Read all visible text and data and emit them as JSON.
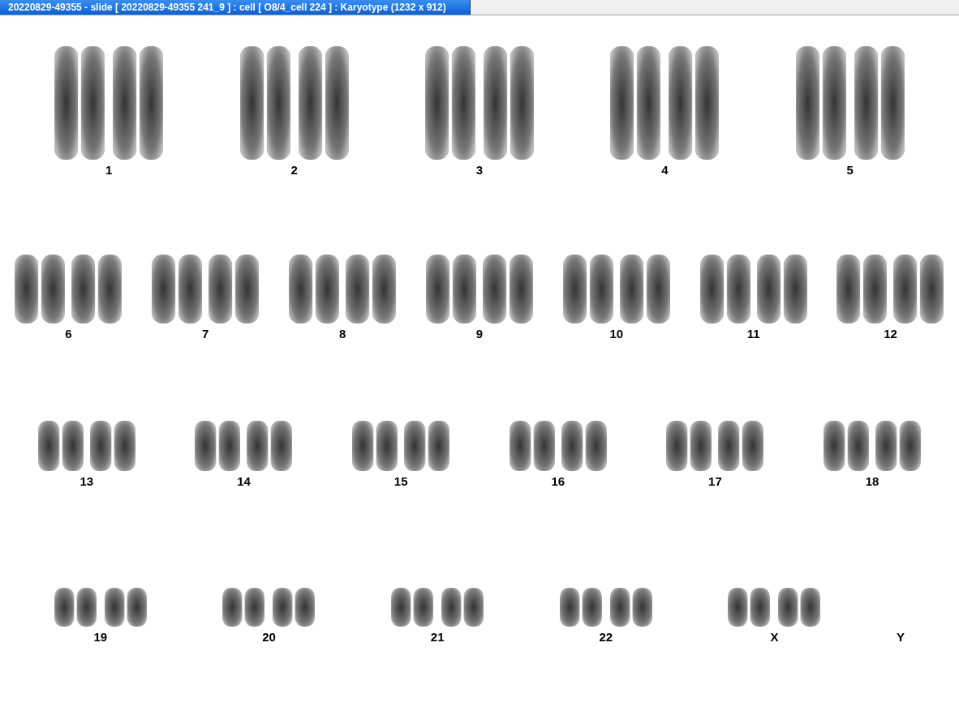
{
  "window": {
    "title": "20220829-49355 - slide [ 20220829-49355 241_9 ] : cell [ O8/4_cell 224 ] : Karyotype  (1232 x 912)"
  },
  "karyotype": {
    "rows": [
      {
        "pairs": [
          {
            "label": "1",
            "kind": "pair"
          },
          {
            "label": "2",
            "kind": "pair"
          },
          {
            "label": "3",
            "kind": "pair"
          },
          {
            "label": "4",
            "kind": "pair"
          },
          {
            "label": "5",
            "kind": "pair"
          }
        ]
      },
      {
        "pairs": [
          {
            "label": "6",
            "kind": "pair"
          },
          {
            "label": "7",
            "kind": "pair"
          },
          {
            "label": "8",
            "kind": "pair"
          },
          {
            "label": "9",
            "kind": "pair"
          },
          {
            "label": "10",
            "kind": "pair"
          },
          {
            "label": "11",
            "kind": "pair"
          },
          {
            "label": "12",
            "kind": "pair"
          }
        ]
      },
      {
        "pairs": [
          {
            "label": "13",
            "kind": "pair"
          },
          {
            "label": "14",
            "kind": "pair"
          },
          {
            "label": "15",
            "kind": "pair"
          },
          {
            "label": "16",
            "kind": "pair"
          },
          {
            "label": "17",
            "kind": "pair"
          },
          {
            "label": "18",
            "kind": "pair"
          }
        ]
      },
      {
        "pairs": [
          {
            "label": "19",
            "kind": "pair"
          },
          {
            "label": "20",
            "kind": "pair"
          },
          {
            "label": "21",
            "kind": "pair"
          },
          {
            "label": "22",
            "kind": "pair"
          },
          {
            "label": "X",
            "kind": "pair"
          },
          {
            "label": "Y",
            "kind": "empty"
          }
        ]
      }
    ]
  }
}
